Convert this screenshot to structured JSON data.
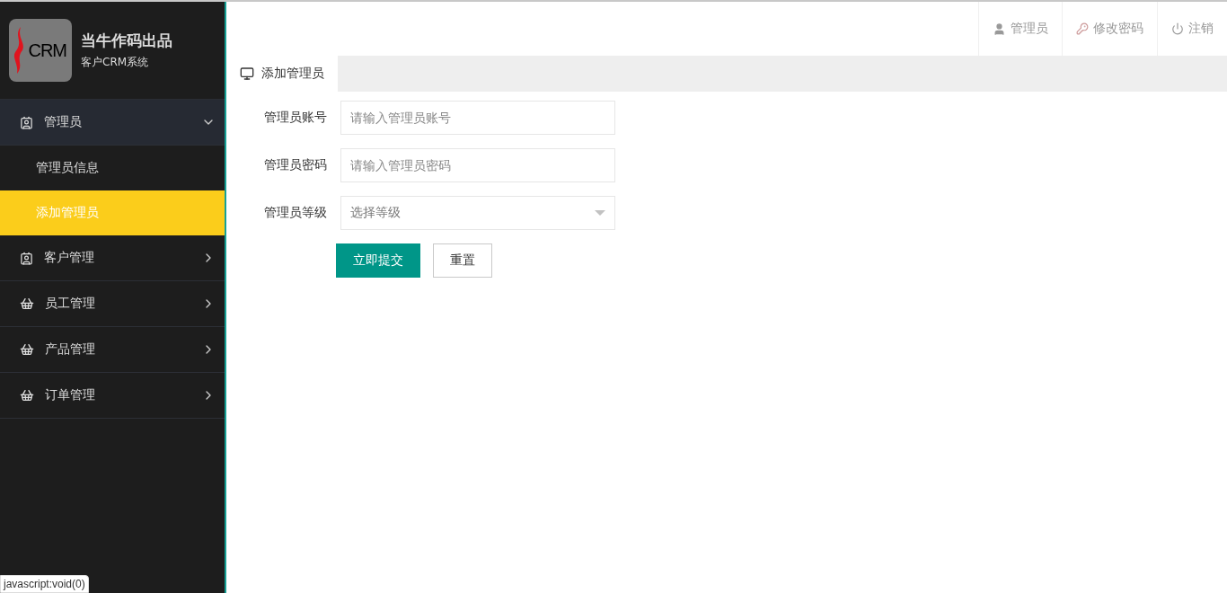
{
  "brand": {
    "logo_text": "CRM",
    "title": "当牛作码出品",
    "subtitle": "客户CRM系统"
  },
  "sidebar": {
    "items": [
      {
        "label": "管理员",
        "expanded": true,
        "children": [
          {
            "label": "管理员信息",
            "selected": false
          },
          {
            "label": "添加管理员",
            "selected": true
          }
        ]
      },
      {
        "label": "客户管理",
        "expanded": false
      },
      {
        "label": "员工管理",
        "expanded": false
      },
      {
        "label": "产品管理",
        "expanded": false
      },
      {
        "label": "订单管理",
        "expanded": false
      }
    ]
  },
  "header": {
    "links": [
      {
        "kind": "user",
        "label": "管理员"
      },
      {
        "kind": "key",
        "label": "修改密码"
      },
      {
        "kind": "power",
        "label": "注销"
      }
    ]
  },
  "tabs": [
    {
      "label": "添加管理员",
      "selected": true
    }
  ],
  "form": {
    "fields": [
      {
        "kind": "input",
        "label": "管理员账号",
        "placeholder": "请输入管理员账号"
      },
      {
        "kind": "input",
        "label": "管理员密码",
        "placeholder": "请输入管理员密码"
      },
      {
        "kind": "select",
        "label": "管理员等级",
        "placeholder": "选择等级"
      }
    ],
    "buttons": [
      {
        "kind": "primary",
        "label": "立即提交"
      },
      {
        "kind": "default",
        "label": "重置"
      }
    ]
  },
  "status_bar": "javascript:void(0)"
}
